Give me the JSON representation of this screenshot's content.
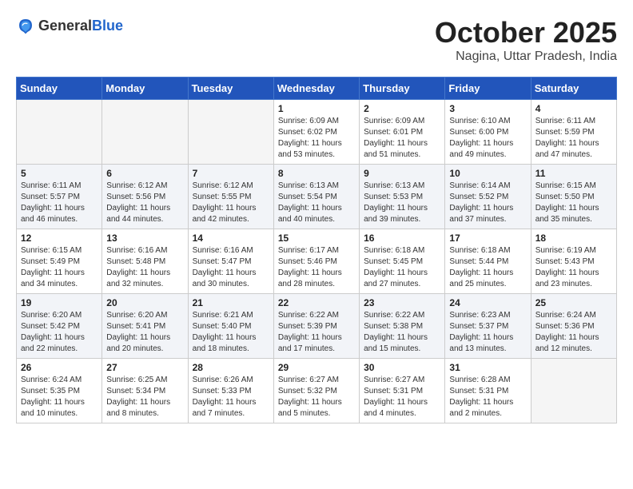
{
  "logo": {
    "general": "General",
    "blue": "Blue"
  },
  "header": {
    "month": "October 2025",
    "location": "Nagina, Uttar Pradesh, India"
  },
  "weekdays": [
    "Sunday",
    "Monday",
    "Tuesday",
    "Wednesday",
    "Thursday",
    "Friday",
    "Saturday"
  ],
  "weeks": [
    [
      {
        "day": "",
        "empty": true
      },
      {
        "day": "",
        "empty": true
      },
      {
        "day": "",
        "empty": true
      },
      {
        "day": "1",
        "sunrise": "6:09 AM",
        "sunset": "6:02 PM",
        "daylight": "11 hours and 53 minutes."
      },
      {
        "day": "2",
        "sunrise": "6:09 AM",
        "sunset": "6:01 PM",
        "daylight": "11 hours and 51 minutes."
      },
      {
        "day": "3",
        "sunrise": "6:10 AM",
        "sunset": "6:00 PM",
        "daylight": "11 hours and 49 minutes."
      },
      {
        "day": "4",
        "sunrise": "6:11 AM",
        "sunset": "5:59 PM",
        "daylight": "11 hours and 47 minutes."
      }
    ],
    [
      {
        "day": "5",
        "sunrise": "6:11 AM",
        "sunset": "5:57 PM",
        "daylight": "11 hours and 46 minutes."
      },
      {
        "day": "6",
        "sunrise": "6:12 AM",
        "sunset": "5:56 PM",
        "daylight": "11 hours and 44 minutes."
      },
      {
        "day": "7",
        "sunrise": "6:12 AM",
        "sunset": "5:55 PM",
        "daylight": "11 hours and 42 minutes."
      },
      {
        "day": "8",
        "sunrise": "6:13 AM",
        "sunset": "5:54 PM",
        "daylight": "11 hours and 40 minutes."
      },
      {
        "day": "9",
        "sunrise": "6:13 AM",
        "sunset": "5:53 PM",
        "daylight": "11 hours and 39 minutes."
      },
      {
        "day": "10",
        "sunrise": "6:14 AM",
        "sunset": "5:52 PM",
        "daylight": "11 hours and 37 minutes."
      },
      {
        "day": "11",
        "sunrise": "6:15 AM",
        "sunset": "5:50 PM",
        "daylight": "11 hours and 35 minutes."
      }
    ],
    [
      {
        "day": "12",
        "sunrise": "6:15 AM",
        "sunset": "5:49 PM",
        "daylight": "11 hours and 34 minutes."
      },
      {
        "day": "13",
        "sunrise": "6:16 AM",
        "sunset": "5:48 PM",
        "daylight": "11 hours and 32 minutes."
      },
      {
        "day": "14",
        "sunrise": "6:16 AM",
        "sunset": "5:47 PM",
        "daylight": "11 hours and 30 minutes."
      },
      {
        "day": "15",
        "sunrise": "6:17 AM",
        "sunset": "5:46 PM",
        "daylight": "11 hours and 28 minutes."
      },
      {
        "day": "16",
        "sunrise": "6:18 AM",
        "sunset": "5:45 PM",
        "daylight": "11 hours and 27 minutes."
      },
      {
        "day": "17",
        "sunrise": "6:18 AM",
        "sunset": "5:44 PM",
        "daylight": "11 hours and 25 minutes."
      },
      {
        "day": "18",
        "sunrise": "6:19 AM",
        "sunset": "5:43 PM",
        "daylight": "11 hours and 23 minutes."
      }
    ],
    [
      {
        "day": "19",
        "sunrise": "6:20 AM",
        "sunset": "5:42 PM",
        "daylight": "11 hours and 22 minutes."
      },
      {
        "day": "20",
        "sunrise": "6:20 AM",
        "sunset": "5:41 PM",
        "daylight": "11 hours and 20 minutes."
      },
      {
        "day": "21",
        "sunrise": "6:21 AM",
        "sunset": "5:40 PM",
        "daylight": "11 hours and 18 minutes."
      },
      {
        "day": "22",
        "sunrise": "6:22 AM",
        "sunset": "5:39 PM",
        "daylight": "11 hours and 17 minutes."
      },
      {
        "day": "23",
        "sunrise": "6:22 AM",
        "sunset": "5:38 PM",
        "daylight": "11 hours and 15 minutes."
      },
      {
        "day": "24",
        "sunrise": "6:23 AM",
        "sunset": "5:37 PM",
        "daylight": "11 hours and 13 minutes."
      },
      {
        "day": "25",
        "sunrise": "6:24 AM",
        "sunset": "5:36 PM",
        "daylight": "11 hours and 12 minutes."
      }
    ],
    [
      {
        "day": "26",
        "sunrise": "6:24 AM",
        "sunset": "5:35 PM",
        "daylight": "11 hours and 10 minutes."
      },
      {
        "day": "27",
        "sunrise": "6:25 AM",
        "sunset": "5:34 PM",
        "daylight": "11 hours and 8 minutes."
      },
      {
        "day": "28",
        "sunrise": "6:26 AM",
        "sunset": "5:33 PM",
        "daylight": "11 hours and 7 minutes."
      },
      {
        "day": "29",
        "sunrise": "6:27 AM",
        "sunset": "5:32 PM",
        "daylight": "11 hours and 5 minutes."
      },
      {
        "day": "30",
        "sunrise": "6:27 AM",
        "sunset": "5:31 PM",
        "daylight": "11 hours and 4 minutes."
      },
      {
        "day": "31",
        "sunrise": "6:28 AM",
        "sunset": "5:31 PM",
        "daylight": "11 hours and 2 minutes."
      },
      {
        "day": "",
        "empty": true
      }
    ]
  ],
  "labels": {
    "sunrise": "Sunrise:",
    "sunset": "Sunset:",
    "daylight": "Daylight hours"
  }
}
